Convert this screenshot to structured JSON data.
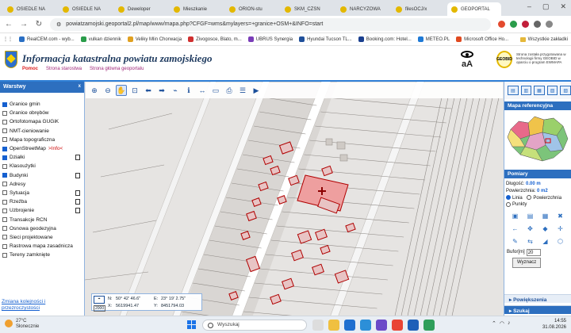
{
  "browser": {
    "tabs": [
      {
        "label": "OSIEDLE NA"
      },
      {
        "label": "OSIEDLE NA"
      },
      {
        "label": "Deweloper"
      },
      {
        "label": "Mieszkanie"
      },
      {
        "label": "ORION-stu"
      },
      {
        "label": "SKM_CZSN"
      },
      {
        "label": "NARCYZOWA"
      },
      {
        "label": "filesOCJ/x"
      },
      {
        "label": "GEOPORTAL",
        "active": true
      }
    ],
    "url": "powiatzamojski.geoportal2.pl/map/www/mapa.php?CFGF=wms&mylayers=+granice+OSM+&INFO=start",
    "bookmarks": [
      {
        "label": "RealCEM.com - wyb...",
        "color": "#2a6fc4"
      },
      {
        "label": "vulkan dziennik",
        "color": "#2a9c4a"
      },
      {
        "label": "Veliky Mlin Chorwacja",
        "color": "#e0a020"
      },
      {
        "label": "Zivogosce, Blato, m...",
        "color": "#d03030"
      },
      {
        "label": "UBRUS Synergia",
        "color": "#7a3db8"
      },
      {
        "label": "Hyundai Tucson TL...",
        "color": "#1f4f9a"
      },
      {
        "label": "Booking.com: Hotel...",
        "color": "#1a3f8f"
      },
      {
        "label": "METEO.PL",
        "color": "#1f7ad6"
      },
      {
        "label": "Microsoft Office Ho...",
        "color": "#e04a20"
      }
    ],
    "bookmarks_right": "Wszystkie zakładki"
  },
  "header": {
    "title": "Informacja katastralna powiatu zamojskiego",
    "links": [
      "Pomoc",
      "Strona starostwa",
      "Strona główna geoportalu"
    ],
    "font_toggle": "aA",
    "badge": "GEOBID",
    "badge_text": "Strona została przygotowana w technologii firmy GEOBID w oparciu o program EWMAPA"
  },
  "left_panel": {
    "title": "Warstwy",
    "close": "x",
    "layers": [
      {
        "label": "Granice gmin",
        "checked": true
      },
      {
        "label": "Granice obrębów",
        "checked": false
      },
      {
        "label": "Ortofotomapa GUGiK",
        "checked": false
      },
      {
        "label": "NMT-cieniowanie",
        "checked": false
      },
      {
        "label": "Mapa topograficzna",
        "checked": false
      },
      {
        "label": "OpenStreetMap",
        "info": ">Info<",
        "checked": true
      },
      {
        "label": "Działki",
        "checked": true,
        "doc": true
      },
      {
        "label": "Klasoużytki",
        "checked": false
      },
      {
        "label": "Budynki",
        "checked": true,
        "doc": true
      },
      {
        "label": "Adresy",
        "checked": false
      },
      {
        "label": "Sytuacja",
        "checked": false,
        "doc": true
      },
      {
        "label": "Rzeźba",
        "checked": false,
        "doc": true
      },
      {
        "label": "Uzbrojenie",
        "checked": false,
        "doc": true
      },
      {
        "label": "Transakcje RCN",
        "checked": false
      },
      {
        "label": "Osnowa geodezyjna",
        "checked": false
      },
      {
        "label": "Sieci projektowane",
        "checked": false
      },
      {
        "label": "Rastrowa mapa zasadnicza",
        "checked": false
      },
      {
        "label": "Tereny zamknięte",
        "checked": false
      }
    ],
    "footer": "Zmiana kolejności i przezroczystości"
  },
  "map": {
    "tools": [
      "zoom-in",
      "zoom-out",
      "pan",
      "zoom-window",
      "back",
      "forward",
      "measure",
      "info",
      "distance",
      "area",
      "print",
      "layers",
      "camera"
    ],
    "coords": {
      "n_label": "N:",
      "n_value": "50° 42' 46.6\"",
      "e_label": "E:",
      "e_value": "23° 19' 2.75\"",
      "x_label": "X:",
      "x_value": "5619941.47",
      "y_label": "Y:",
      "y_value": "8451794.03",
      "system": "2000"
    }
  },
  "right_panel": {
    "ref_title": "Mapa referencyjna",
    "measure_title": "Pomiary",
    "length_label": "Długość:",
    "length_value": "0.00 m",
    "area_label": "Powierzchnia:",
    "area_value": "0 m2",
    "modes": [
      "Linia",
      "Powierzchnia",
      "Punkty"
    ],
    "buffer_label": "Bufor[m]",
    "buffer_value": "20",
    "compute_button": "Wyznacz",
    "sections": [
      "Powiększenia",
      "Szukaj"
    ]
  },
  "taskbar": {
    "weather_temp": "27°C",
    "weather_desc": "Słonecznie",
    "search_placeholder": "Wyszukaj",
    "time": "14:55",
    "date": "31.08.2026"
  },
  "colors": {
    "accent": "#2d6fbf",
    "parcel_outline": "#b00000",
    "selected_parcel": "#ee9f9f"
  }
}
